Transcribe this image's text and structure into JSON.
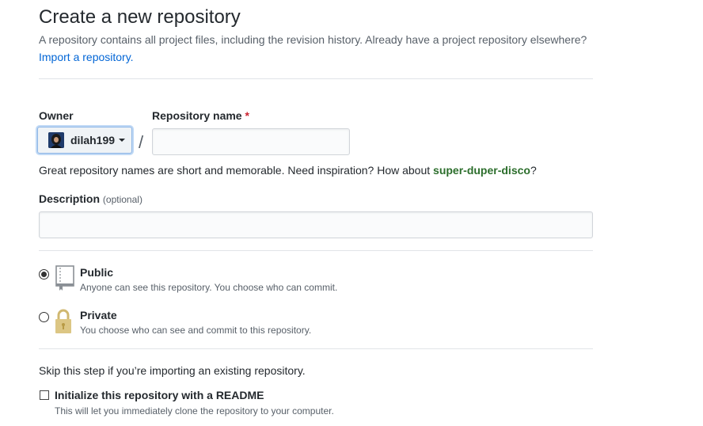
{
  "header": {
    "title": "Create a new repository",
    "subtitle": "A repository contains all project files, including the revision history. Already have a project repository elsewhere?",
    "import_link": "Import a repository."
  },
  "owner": {
    "label": "Owner",
    "selected": "dilah199"
  },
  "repo_name": {
    "label": "Repository name",
    "required_mark": "*",
    "value": "",
    "separator": "/"
  },
  "naming_hint": {
    "text": "Great repository names are short and memorable. Need inspiration? How about ",
    "suggestion": "super-duper-disco",
    "end": "?"
  },
  "description": {
    "label": "Description",
    "optional": "(optional)",
    "value": ""
  },
  "visibility": {
    "selected": "public",
    "options": [
      {
        "id": "public",
        "title": "Public",
        "desc": "Anyone can see this repository. You choose who can commit."
      },
      {
        "id": "private",
        "title": "Private",
        "desc": "You choose who can see and commit to this repository."
      }
    ]
  },
  "init": {
    "skip_note": "Skip this step if you’re importing an existing repository.",
    "readme_label": "Initialize this repository with a README",
    "readme_desc": "This will let you immediately clone the repository to your computer.",
    "readme_checked": false
  }
}
